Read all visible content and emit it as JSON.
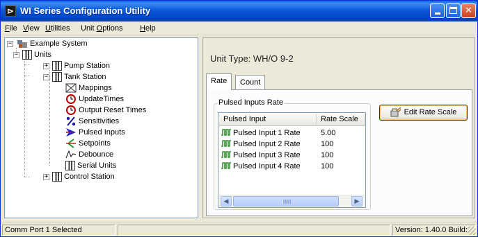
{
  "window": {
    "title": "WI Series Configuration Utility",
    "app_icon_glyph": "⊳"
  },
  "menu": {
    "file": {
      "pre": "",
      "key": "F",
      "post": "ile"
    },
    "view": {
      "pre": "",
      "key": "V",
      "post": "iew"
    },
    "utilities": {
      "pre": "",
      "key": "U",
      "post": "tilities"
    },
    "unit_options": {
      "pre": "Unit ",
      "key": "O",
      "post": "ptions"
    },
    "help": {
      "pre": "",
      "key": "H",
      "post": "elp"
    }
  },
  "tree": {
    "example_system": "Example System",
    "units": "Units",
    "pump_station": "Pump Station",
    "tank_station": "Tank Station",
    "mappings": "Mappings",
    "update_times": "UpdateTimes",
    "output_reset_times": "Output Reset Times",
    "sensitivities": "Sensitivities",
    "pulsed_inputs": "Pulsed Inputs",
    "setpoints": "Setpoints",
    "debounce": "Debounce",
    "serial_units": "Serial Units",
    "control_station": "Control Station"
  },
  "detail": {
    "unit_type": "Unit Type:   WH/O 9-2",
    "tabs": {
      "rate": "Rate",
      "count": "Count"
    },
    "group_label": "Pulsed Inputs Rate",
    "columns": {
      "input": "Pulsed Input",
      "scale": "Rate Scale"
    },
    "rows": [
      {
        "name": "Pulsed Input 1 Rate",
        "value": "5.00"
      },
      {
        "name": "Pulsed Input 2 Rate",
        "value": "100"
      },
      {
        "name": "Pulsed Input 3 Rate",
        "value": "100"
      },
      {
        "name": "Pulsed Input 4 Rate",
        "value": "100"
      }
    ],
    "edit_button": "Edit Rate Scale"
  },
  "status": {
    "left": "Comm Port 1 Selected",
    "middle": "",
    "right": "Version: 1.40.0 Build: "
  },
  "colors": {
    "title_bar": "#0054e3",
    "close_button": "#d9512c",
    "pulsed_inputs_arrow": "#1a1ac8",
    "pulse_icon": "#2a8a2a"
  }
}
